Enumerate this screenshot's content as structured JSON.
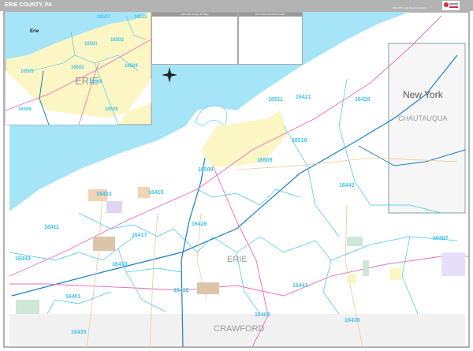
{
  "header": {
    "title": "ERIE COUNTY, PA",
    "edition": "2026 ZIP Code Premium Edition",
    "logo_text": "Market MAPS"
  },
  "legend": {
    "title": "2026 Erie County ZIP Map"
  },
  "index": {
    "title": "ZIP Code Index/Grid Locator"
  },
  "regions": {
    "county_main": "ERIE",
    "county_inset": "ERIE",
    "county_south": "CRAWFORD",
    "state_east": "New York",
    "county_east": "CHAUTAUQUA",
    "inset_city": "Erie"
  },
  "inset_zips": [
    "16507",
    "16511",
    "16503",
    "16501",
    "16502",
    "16505",
    "16504",
    "16508",
    "16506",
    "16509"
  ],
  "main_zips": [
    "16511",
    "16421",
    "16428",
    "16510",
    "16509",
    "16508",
    "16442",
    "16423",
    "16415",
    "16411",
    "16426",
    "16417",
    "16443",
    "16410",
    "16407",
    "16412",
    "16441",
    "16401",
    "16403",
    "16438",
    "16435"
  ],
  "colors": {
    "water": "#a6e4f7",
    "urban": "#fbf6c4",
    "zip_boundary": "#3fc3ec",
    "interstate": "#1a7fc4",
    "us_route": "#f06aba",
    "state_route": "#f5c78e",
    "header": "#b3b3b3",
    "outside_area": "#f1f1f1"
  }
}
